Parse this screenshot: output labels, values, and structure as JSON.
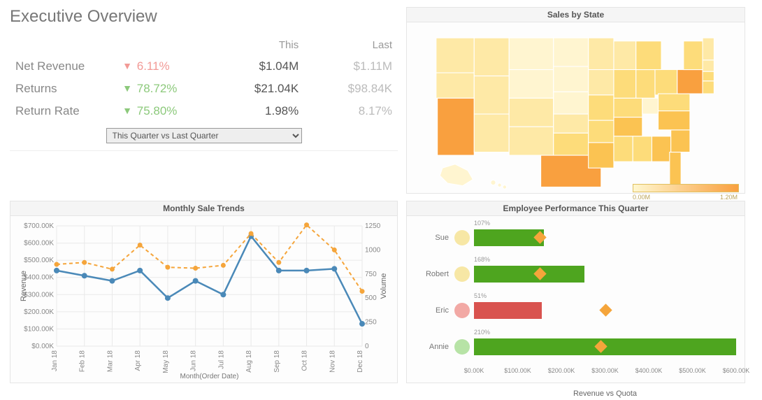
{
  "header": {
    "title": "Executive Overview"
  },
  "overview": {
    "cols": {
      "this": "This",
      "last": "Last"
    },
    "rows": [
      {
        "label": "Net Revenue",
        "dir": "down",
        "change": "6.11%",
        "this": "$1.04M",
        "last": "$1.11M"
      },
      {
        "label": "Returns",
        "dir": "up",
        "change": "78.72%",
        "this": "$21.04K",
        "last": "$98.84K"
      },
      {
        "label": "Return Rate",
        "dir": "up",
        "change": "75.80%",
        "this": "1.98%",
        "last": "8.17%"
      }
    ],
    "period_select": "This Quarter vs Last Quarter"
  },
  "map": {
    "title": "Sales by State",
    "legend_min": "0.00M",
    "legend_max": "1.20M"
  },
  "trends": {
    "title": "Monthly Sale Trends",
    "xlabel": "Month(Order Date)",
    "ylabel_left": "Revenue",
    "ylabel_right": "Volume"
  },
  "employee": {
    "title": "Employee Performance This Quarter",
    "xlabel": "Revenue vs Quota",
    "rows": [
      {
        "name": "Sue",
        "pct": "107%",
        "status": "yellow",
        "bar_color": "green",
        "value": 160000,
        "quota": 150000
      },
      {
        "name": "Robert",
        "pct": "168%",
        "status": "yellow",
        "bar_color": "green",
        "value": 252000,
        "quota": 150000
      },
      {
        "name": "Eric",
        "pct": "51%",
        "status": "red",
        "bar_color": "red",
        "value": 155000,
        "quota": 300000
      },
      {
        "name": "Annie",
        "pct": "210%",
        "status": "green",
        "bar_color": "green",
        "value": 610000,
        "quota": 290000
      }
    ],
    "axis_ticks": [
      "$0.00K",
      "$100.00K",
      "$200.00K",
      "$300.00K",
      "$400.00K",
      "$500.00K",
      "$600.00K"
    ]
  },
  "chart_data": [
    {
      "type": "line",
      "title": "Monthly Sale Trends",
      "categories": [
        "Jan 18",
        "Feb 18",
        "Mar 18",
        "Apr 18",
        "May 18",
        "Jun 18",
        "Jul 18",
        "Aug 18",
        "Sep 18",
        "Oct 18",
        "Nov 18",
        "Dec 18"
      ],
      "series": [
        {
          "name": "Revenue",
          "axis": "left",
          "values": [
            440000,
            410000,
            380000,
            440000,
            280000,
            380000,
            300000,
            640000,
            440000,
            440000,
            450000,
            130000
          ]
        },
        {
          "name": "Volume",
          "axis": "right",
          "style": "dashed",
          "values": [
            850,
            870,
            800,
            1050,
            820,
            810,
            840,
            1170,
            870,
            1260,
            1000,
            570
          ]
        }
      ],
      "xlabel": "Month(Order Date)",
      "ylabel": "Revenue",
      "ylabel2": "Volume",
      "ylim": [
        0,
        700000
      ],
      "ylim2": [
        0,
        1250
      ],
      "yticks": [
        "$0.00K",
        "$100.00K",
        "$200.00K",
        "$300.00K",
        "$400.00K",
        "$500.00K",
        "$600.00K",
        "$700.00K"
      ],
      "yticks2": [
        0,
        250,
        500,
        750,
        1000,
        1250
      ]
    },
    {
      "type": "bar",
      "title": "Employee Performance This Quarter",
      "orientation": "horizontal",
      "categories": [
        "Sue",
        "Robert",
        "Eric",
        "Annie"
      ],
      "series": [
        {
          "name": "Revenue",
          "values": [
            160000,
            252000,
            155000,
            610000
          ]
        },
        {
          "name": "Quota",
          "values": [
            150000,
            150000,
            300000,
            290000
          ],
          "marker": "diamond"
        }
      ],
      "annotations": [
        "107%",
        "168%",
        "51%",
        "210%"
      ],
      "xlabel": "Revenue vs Quota",
      "xlim": [
        0,
        600000
      ],
      "xticks": [
        0,
        100000,
        200000,
        300000,
        400000,
        500000,
        600000
      ]
    },
    {
      "type": "choropleth",
      "title": "Sales by State",
      "region": "USA",
      "color_scale": [
        "#fff7cf",
        "#f9a03f"
      ],
      "scale_domain": [
        0,
        1200000
      ],
      "legend": [
        "0.00M",
        "1.20M"
      ],
      "data": {
        "CA": 1200000,
        "TX": 1000000,
        "PA": 950000,
        "FL": 700000,
        "NY": 450000,
        "OH": 420000,
        "IL": 410000,
        "GA": 430000,
        "NC": 420000,
        "TN": 450000,
        "LA": 460000,
        "MO": 420000,
        "IN": 440000,
        "VA": 430000,
        "MA": 410000,
        "SC": 440000,
        "AL": 430000,
        "MS": 410000,
        "OK": 380000,
        "AR": 400000,
        "KY": 380000,
        "WI": 300000,
        "MN": 280000,
        "CO": 290000,
        "UT": 290000,
        "AZ": 300000,
        "NM": 270000,
        "KS": 260000,
        "NE": 220000,
        "IA": 250000,
        "WA": 240000,
        "OR": 230000,
        "NV": 220000,
        "ID": 200000,
        "MT": 180000,
        "WY": 170000,
        "SD": 190000,
        "ND": 180000,
        "MI": 360000,
        "NJ": 400000,
        "MD": 380000,
        "CT": 300000,
        "ME": 220000,
        "NH": 210000,
        "VT": 180000,
        "RI": 200000,
        "DE": 210000,
        "WV": 150000,
        "AK": 80000,
        "HI": 120000
      }
    }
  ]
}
